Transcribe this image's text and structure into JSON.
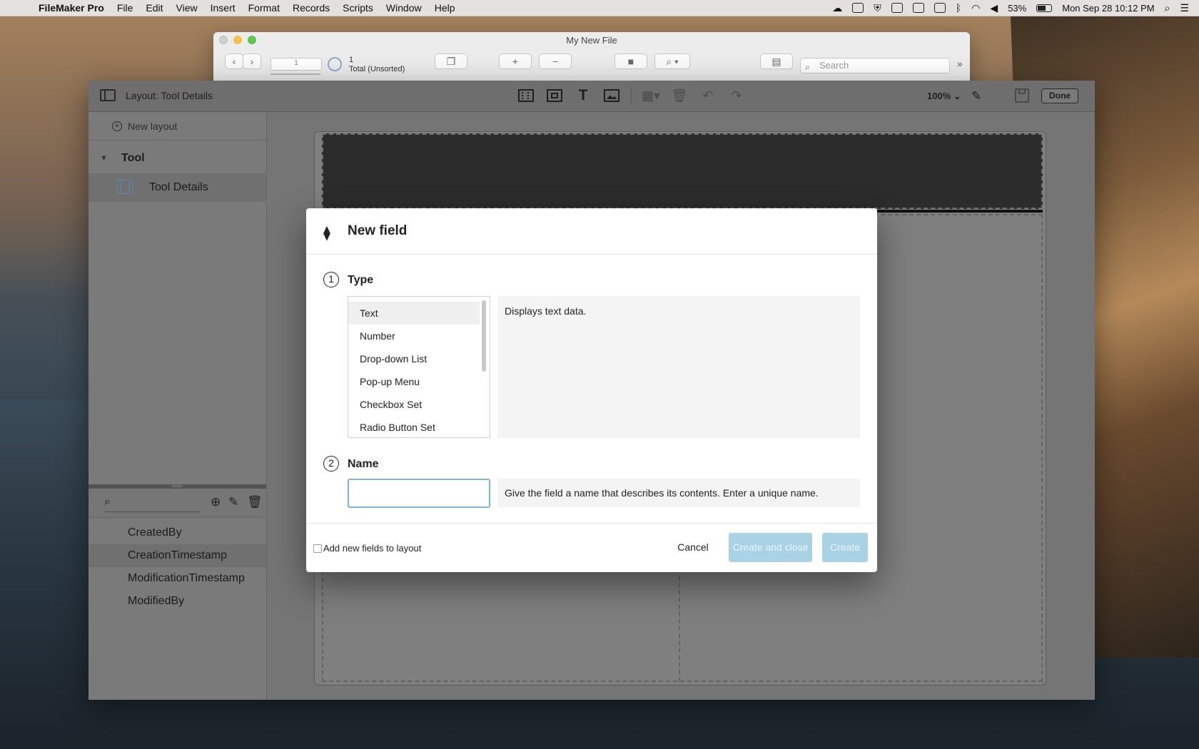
{
  "menubar": {
    "app_name": "FileMaker Pro",
    "menus": [
      "File",
      "Edit",
      "View",
      "Insert",
      "Format",
      "Records",
      "Scripts",
      "Window",
      "Help"
    ],
    "battery": "53%",
    "datetime": "Mon Sep 28  10:12 PM"
  },
  "file_window": {
    "title": "My New File",
    "record_input": "1",
    "record_count": "1",
    "record_status": "Total (Unsorted)",
    "search_placeholder": "Search"
  },
  "layout_window": {
    "title": "Layout: Tool Details",
    "zoom": "100%",
    "done_label": "Done",
    "new_layout_label": "New layout",
    "group_name": "Tool",
    "layout_item": "Tool Details",
    "fields": [
      "CreatedBy",
      "CreationTimestamp",
      "ModificationTimestamp",
      "ModifiedBy"
    ],
    "selected_field": "CreationTimestamp"
  },
  "dialog": {
    "title": "New field",
    "step1_number": "1",
    "step1_label": "Type",
    "types": [
      "Text",
      "Number",
      "Drop-down List",
      "Pop-up Menu",
      "Checkbox Set",
      "Radio Button Set"
    ],
    "selected_type": "Text",
    "type_description": "Displays text data.",
    "step2_number": "2",
    "step2_label": "Name",
    "name_value": "",
    "name_hint": "Give the field a name that describes its contents. Enter a unique name.",
    "add_to_layout_label": "Add new fields to layout",
    "add_to_layout_checked": false,
    "cancel_label": "Cancel",
    "create_close_label": "Create and close",
    "create_label": "Create"
  },
  "colors": {
    "accent_disabled": "#a9d2e4",
    "input_focus": "#7cb5dd",
    "selection_gray": "#efefef"
  }
}
